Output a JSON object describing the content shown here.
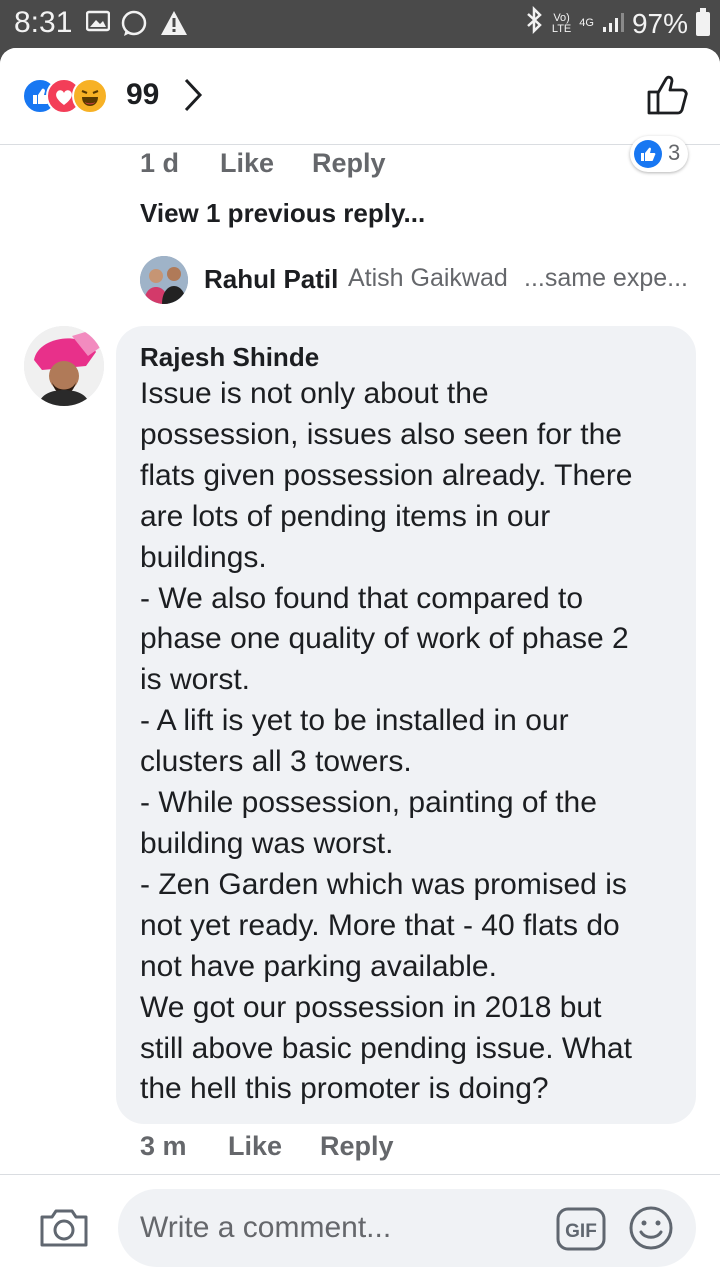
{
  "status_bar": {
    "time": "8:31",
    "volte": "Vo)",
    "lte": "LTE",
    "network": "4G",
    "battery": "97%"
  },
  "header": {
    "reaction_count": "99",
    "reaction_types": [
      "like",
      "love",
      "haha"
    ]
  },
  "previous_comment": {
    "time": "1 d",
    "like_label": "Like",
    "reply_label": "Reply",
    "like_count": "3"
  },
  "view_previous": "View 1 previous reply...",
  "reply_preview": {
    "author": "Rahul Patil",
    "mention": "Atish Gaikwad",
    "snippet": "...same expe..."
  },
  "comment": {
    "author": "Rajesh Shinde",
    "text": "Issue is not only about the\npossession, issues also seen for the\nflats given possession already. There\nare lots of pending items in our\nbuildings.\n- We also found that compared to\nphase one quality of work of phase 2\nis worst.\n- A lift is yet to be installed in our\nclusters all 3 towers.\n- While possession, painting of the\nbuilding was worst.\n- Zen Garden which was promised is\nnot yet ready. More that - 40 flats do\nnot have parking available.\nWe got our possession in 2018 but\nstill above basic pending issue. What\nthe hell this promoter is doing?",
    "time": "3 m",
    "like_label": "Like",
    "reply_label": "Reply"
  },
  "composer": {
    "placeholder": "Write a comment...",
    "gif_label": "GIF"
  },
  "colors": {
    "accent": "#1877f2",
    "love": "#f33e58",
    "haha": "#f7b125",
    "bubble": "#f0f2f5",
    "status_bar": "#4a4a4a"
  }
}
